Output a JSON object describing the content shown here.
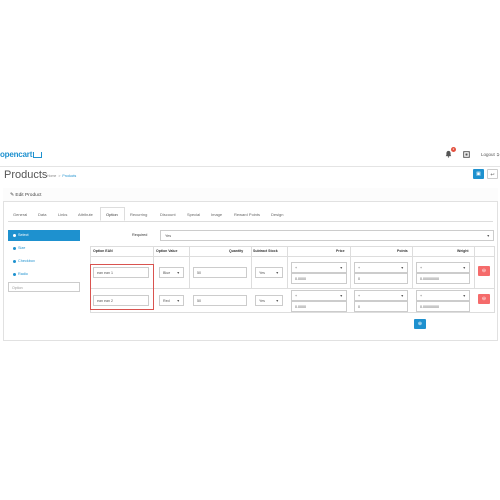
{
  "header": {
    "logo": "opencart",
    "notification_count": "2",
    "logout_label": "Logout"
  },
  "page": {
    "title": "Products",
    "breadcrumb": [
      "Home",
      "Products"
    ]
  },
  "panel": {
    "title": "Edit Product",
    "tabs": [
      "General",
      "Data",
      "Links",
      "Attribute",
      "Option",
      "Recurring",
      "Discount",
      "Special",
      "Image",
      "Reward Points",
      "Design"
    ],
    "active_tab": "Option"
  },
  "side_menu": {
    "items": [
      "Select",
      "Size",
      "Checkbox",
      "Radio"
    ],
    "active": "Select",
    "input_placeholder": "Option"
  },
  "required": {
    "label": "Required",
    "value": "Yes"
  },
  "table": {
    "headers": [
      "Option EAN",
      "Option Value",
      "Quantity",
      "Subtract Stock",
      "Price",
      "Points",
      "Weight"
    ],
    "rows": [
      {
        "ean": "ean ean 1",
        "option_value": "Blue",
        "quantity": "50",
        "subtract": "Yes",
        "price_prefix": "+",
        "price": "0.0000",
        "points_prefix": "+",
        "points": "0",
        "weight_prefix": "+",
        "weight": "0.00000000"
      },
      {
        "ean": "ean ean 2",
        "option_value": "Red",
        "quantity": "50",
        "subtract": "Yes",
        "price_prefix": "+",
        "price": "0.0000",
        "points_prefix": "+",
        "points": "0",
        "weight_prefix": "+",
        "weight": "0.00000000"
      }
    ]
  },
  "icons": {
    "bell": "bell-icon",
    "logout": "sign-out-icon",
    "save": "save-icon",
    "back": "reply-icon",
    "edit": "pencil-icon",
    "delete": "minus-circle-icon",
    "add": "plus-circle-icon"
  },
  "colors": {
    "primary": "#1e91cf",
    "danger": "#f56b6b",
    "highlight": "#d9534f"
  }
}
